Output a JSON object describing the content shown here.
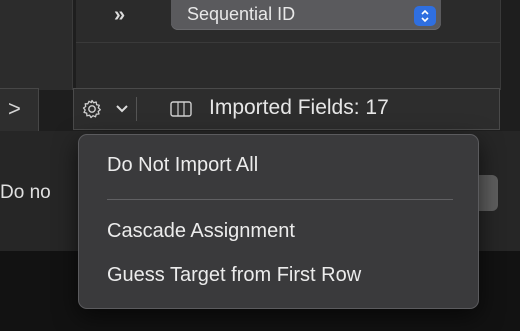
{
  "header": {
    "overflow_glyph": "»",
    "id_select": {
      "value": "Sequential ID",
      "arrows_icon": "up-down-chevron-icon",
      "accent": "#2f6fe0"
    }
  },
  "toolbar": {
    "gear_icon": "gear-icon",
    "chevron_icon": "chevron-down-icon",
    "columns_icon": "columns-icon",
    "imported_label": "Imported Fields: 17"
  },
  "left_panel": {
    "expand_glyph": ">",
    "truncated_text": "Do no"
  },
  "menu": {
    "items": [
      {
        "label": "Do Not Import All"
      },
      {
        "label": "Cascade Assignment"
      },
      {
        "label": "Guess Target from First Row"
      }
    ]
  }
}
